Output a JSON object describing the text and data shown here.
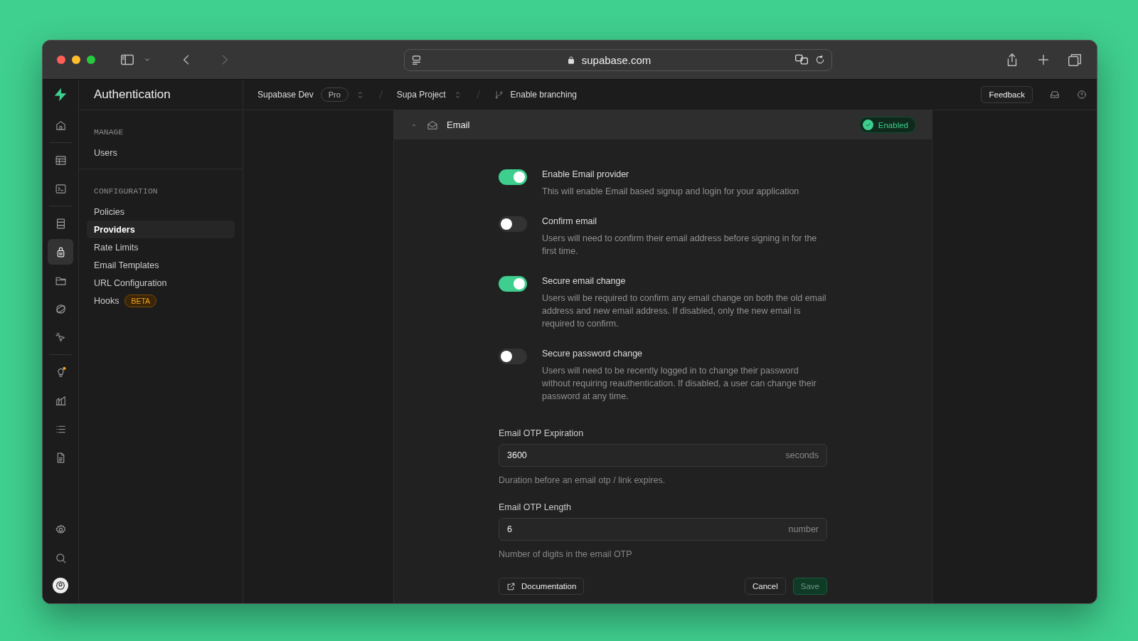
{
  "browser": {
    "url": "supabase.com"
  },
  "rail_items": [
    {
      "selected": false
    },
    {
      "selected": false
    },
    {
      "selected": false
    },
    {
      "selected": false
    },
    {
      "selected": true
    },
    {
      "selected": false
    },
    {
      "selected": false
    },
    {
      "selected": false
    },
    {
      "selected": false
    },
    {
      "selected": false
    },
    {
      "selected": false
    },
    {
      "selected": false
    }
  ],
  "sidebar": {
    "title": "Authentication",
    "sections": [
      {
        "heading": "MANAGE",
        "items": [
          {
            "label": "Users",
            "selected": false
          }
        ]
      },
      {
        "heading": "CONFIGURATION",
        "items": [
          {
            "label": "Policies",
            "selected": false
          },
          {
            "label": "Providers",
            "selected": true
          },
          {
            "label": "Rate Limits",
            "selected": false
          },
          {
            "label": "Email Templates",
            "selected": false
          },
          {
            "label": "URL Configuration",
            "selected": false
          },
          {
            "label": "Hooks",
            "selected": false,
            "badge": "BETA"
          }
        ]
      }
    ]
  },
  "topbar": {
    "organization": "Supabase Dev",
    "plan": "Pro",
    "project": "Supa Project",
    "branching": "Enable branching",
    "feedback": "Feedback"
  },
  "panel": {
    "title": "Email",
    "status": "Enabled",
    "toggles": [
      {
        "label": "Enable Email provider",
        "description": "This will enable Email based signup and login for your application",
        "on": true
      },
      {
        "label": "Confirm email",
        "description": "Users will need to confirm their email address before signing in for the first time.",
        "on": false
      },
      {
        "label": "Secure email change",
        "description": "Users will be required to confirm any email change on both the old email address and new email address. If disabled, only the new email is required to confirm.",
        "on": true
      },
      {
        "label": "Secure password change",
        "description": "Users will need to be recently logged in to change their password without requiring reauthentication. If disabled, a user can change their password at any time.",
        "on": false
      }
    ],
    "fields": [
      {
        "label": "Email OTP Expiration",
        "value": "3600",
        "suffix": "seconds",
        "hint": "Duration before an email otp / link expires."
      },
      {
        "label": "Email OTP Length",
        "value": "6",
        "suffix": "number",
        "hint": "Number of digits in the email OTP"
      }
    ],
    "documentation": "Documentation",
    "cancel": "Cancel",
    "save": {
      "label": "Save",
      "disabled": true
    }
  }
}
